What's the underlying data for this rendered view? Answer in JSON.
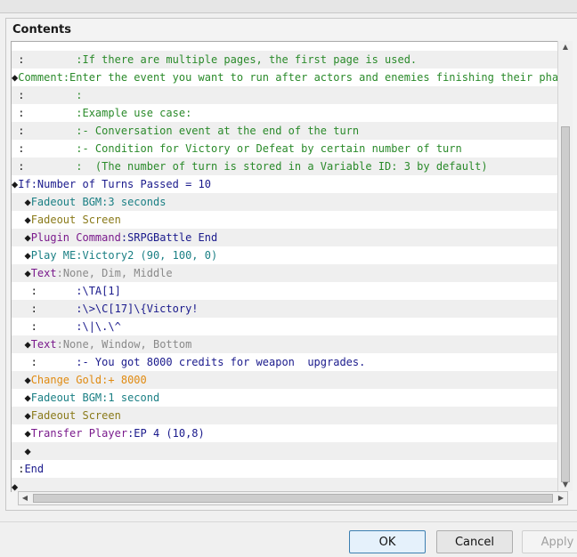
{
  "panel": {
    "title": "Contents"
  },
  "rows": [
    {
      "parts": [
        {
          "t": " :        ",
          "c": "c-dark"
        },
        {
          "t": ":If there are multiple pages, the first page is used.",
          "c": "c-green"
        }
      ]
    },
    {
      "parts": [
        {
          "t": "◆",
          "c": "c-dark"
        },
        {
          "t": "Comment",
          "c": "c-green"
        },
        {
          "t": ":Enter the event you want to run after actors and enemies finishing their phases",
          "c": "c-green"
        }
      ]
    },
    {
      "parts": [
        {
          "t": " :        ",
          "c": "c-dark"
        },
        {
          "t": ":",
          "c": "c-green"
        }
      ]
    },
    {
      "parts": [
        {
          "t": " :        ",
          "c": "c-dark"
        },
        {
          "t": ":Example use case:",
          "c": "c-green"
        }
      ]
    },
    {
      "parts": [
        {
          "t": " :        ",
          "c": "c-dark"
        },
        {
          "t": ":- Conversation event at the end of the turn",
          "c": "c-green"
        }
      ]
    },
    {
      "parts": [
        {
          "t": " :        ",
          "c": "c-dark"
        },
        {
          "t": ":- Condition for Victory or Defeat by certain number of turn",
          "c": "c-green"
        }
      ]
    },
    {
      "parts": [
        {
          "t": " :        ",
          "c": "c-dark"
        },
        {
          "t": ":  (The number of turn is stored in a Variable ID: 3 by default)",
          "c": "c-green"
        }
      ]
    },
    {
      "parts": [
        {
          "t": "◆",
          "c": "c-dark"
        },
        {
          "t": "If",
          "c": "c-navy"
        },
        {
          "t": ":Number of Turns Passed = 10",
          "c": "c-navy"
        }
      ]
    },
    {
      "parts": [
        {
          "t": "  ◆",
          "c": "c-dark"
        },
        {
          "t": "Fadeout BGM",
          "c": "c-teal"
        },
        {
          "t": ":3 seconds",
          "c": "c-teal"
        }
      ]
    },
    {
      "parts": [
        {
          "t": "  ◆",
          "c": "c-dark"
        },
        {
          "t": "Fadeout Screen",
          "c": "c-olive"
        }
      ]
    },
    {
      "parts": [
        {
          "t": "  ◆",
          "c": "c-dark"
        },
        {
          "t": "Plugin Command",
          "c": "c-purple"
        },
        {
          "t": ":SRPGBattle End",
          "c": "c-navy"
        }
      ]
    },
    {
      "parts": [
        {
          "t": "  ◆",
          "c": "c-dark"
        },
        {
          "t": "Play ME",
          "c": "c-teal"
        },
        {
          "t": ":Victory2 (90, 100, 0)",
          "c": "c-teal"
        }
      ]
    },
    {
      "parts": [
        {
          "t": "  ◆",
          "c": "c-dark"
        },
        {
          "t": "Text",
          "c": "c-purple"
        },
        {
          "t": ":None, Dim, Middle",
          "c": "c-gray"
        }
      ]
    },
    {
      "parts": [
        {
          "t": "   :      ",
          "c": "c-dark"
        },
        {
          "t": ":\\TA[1]",
          "c": "c-navy"
        }
      ]
    },
    {
      "parts": [
        {
          "t": "   :      ",
          "c": "c-dark"
        },
        {
          "t": ":\\>\\C[17]\\{Victory!",
          "c": "c-navy"
        }
      ]
    },
    {
      "parts": [
        {
          "t": "   :      ",
          "c": "c-dark"
        },
        {
          "t": ":\\|\\.\\^",
          "c": "c-navy"
        }
      ]
    },
    {
      "parts": [
        {
          "t": "  ◆",
          "c": "c-dark"
        },
        {
          "t": "Text",
          "c": "c-purple"
        },
        {
          "t": ":None, Window, Bottom",
          "c": "c-gray"
        }
      ]
    },
    {
      "parts": [
        {
          "t": "   :      ",
          "c": "c-dark"
        },
        {
          "t": ":- You got 8000 credits for weapon  upgrades.",
          "c": "c-navy"
        }
      ]
    },
    {
      "parts": [
        {
          "t": "  ◆",
          "c": "c-dark"
        },
        {
          "t": "Change Gold",
          "c": "c-orange"
        },
        {
          "t": ":+ 8000",
          "c": "c-orange"
        }
      ]
    },
    {
      "parts": [
        {
          "t": "  ◆",
          "c": "c-dark"
        },
        {
          "t": "Fadeout BGM",
          "c": "c-teal"
        },
        {
          "t": ":1 second",
          "c": "c-teal"
        }
      ]
    },
    {
      "parts": [
        {
          "t": "  ◆",
          "c": "c-dark"
        },
        {
          "t": "Fadeout Screen",
          "c": "c-olive"
        }
      ]
    },
    {
      "parts": [
        {
          "t": "  ◆",
          "c": "c-dark"
        },
        {
          "t": "Transfer Player",
          "c": "c-purple"
        },
        {
          "t": ":EP 4 (10,8)",
          "c": "c-navy"
        }
      ]
    },
    {
      "parts": [
        {
          "t": "  ◆",
          "c": "c-dark"
        }
      ]
    },
    {
      "parts": [
        {
          "t": " :",
          "c": "c-dark"
        },
        {
          "t": "End",
          "c": "c-navy"
        }
      ]
    },
    {
      "parts": [
        {
          "t": "◆",
          "c": "c-dark"
        }
      ]
    }
  ],
  "buttons": {
    "ok": "OK",
    "cancel": "Cancel",
    "apply": "Apply"
  }
}
